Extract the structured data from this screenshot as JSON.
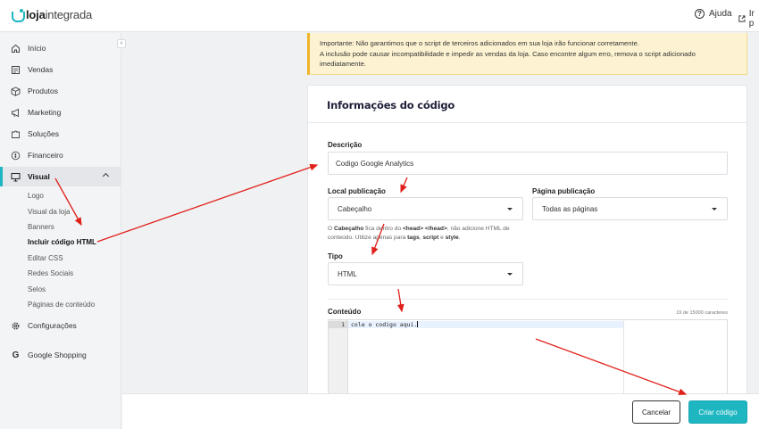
{
  "brand": {
    "bold": "loja",
    "light": "integrada"
  },
  "topbar": {
    "help_label": "Ajuda",
    "goto_label": "Ir p"
  },
  "sidebar": {
    "items": [
      {
        "label": "Início",
        "icon": "home-icon"
      },
      {
        "label": "Vendas",
        "icon": "receipt-icon"
      },
      {
        "label": "Produtos",
        "icon": "box-icon"
      },
      {
        "label": "Marketing",
        "icon": "megaphone-icon"
      },
      {
        "label": "Soluções",
        "icon": "puzzle-icon"
      },
      {
        "label": "Financeiro",
        "icon": "money-icon"
      },
      {
        "label": "Visual",
        "icon": "monitor-icon"
      },
      {
        "label": "Configurações",
        "icon": "gear-icon"
      },
      {
        "label": "Google Shopping",
        "icon": "google-icon"
      }
    ],
    "visual_sub": [
      "Logo",
      "Visual da loja",
      "Banners",
      "Incluir código HTML",
      "Editar CSS",
      "Redes Sociais",
      "Selos",
      "Páginas de conteúdo"
    ]
  },
  "warning": {
    "line1": "Importante: Não garantimos que o script de terceiros adicionados em sua loja irão funcionar corretamente.",
    "line2": "A inclusão pode causar incompatibilidade e impedir as vendas da loja. Caso encontre algum erro, remova o script adicionado imediatamente."
  },
  "form": {
    "title": "Informações do código",
    "descricao_label": "Descrição",
    "descricao_value": "Codigo Google Analytics",
    "local_label": "Local publicação",
    "local_value": "Cabeçalho",
    "pagina_label": "Página publicação",
    "pagina_value": "Todas as páginas",
    "hint": {
      "p1": "O ",
      "b1": "Cabeçalho",
      "p2": " fica dentro do ",
      "b2": "<head> </head>",
      "p3": ", não adicione HTML de conteúdo. Utilize apenas para ",
      "b3": "tags",
      "p4": ", ",
      "b4": "script",
      "p5": " e ",
      "b5": "style",
      "p6": "."
    },
    "tipo_label": "Tipo",
    "tipo_value": "HTML",
    "conteudo_label": "Conteúdo",
    "counter": "19 de 15000 caracteres",
    "editor": {
      "line_number": "1",
      "code": "cole o codigo aqui."
    }
  },
  "footer": {
    "cancel_label": "Cancelar",
    "create_label": "Criar código"
  },
  "colors": {
    "accent": "#1db6c1",
    "warning_bg": "#fdf3d2",
    "arrow": "#e0201a"
  }
}
